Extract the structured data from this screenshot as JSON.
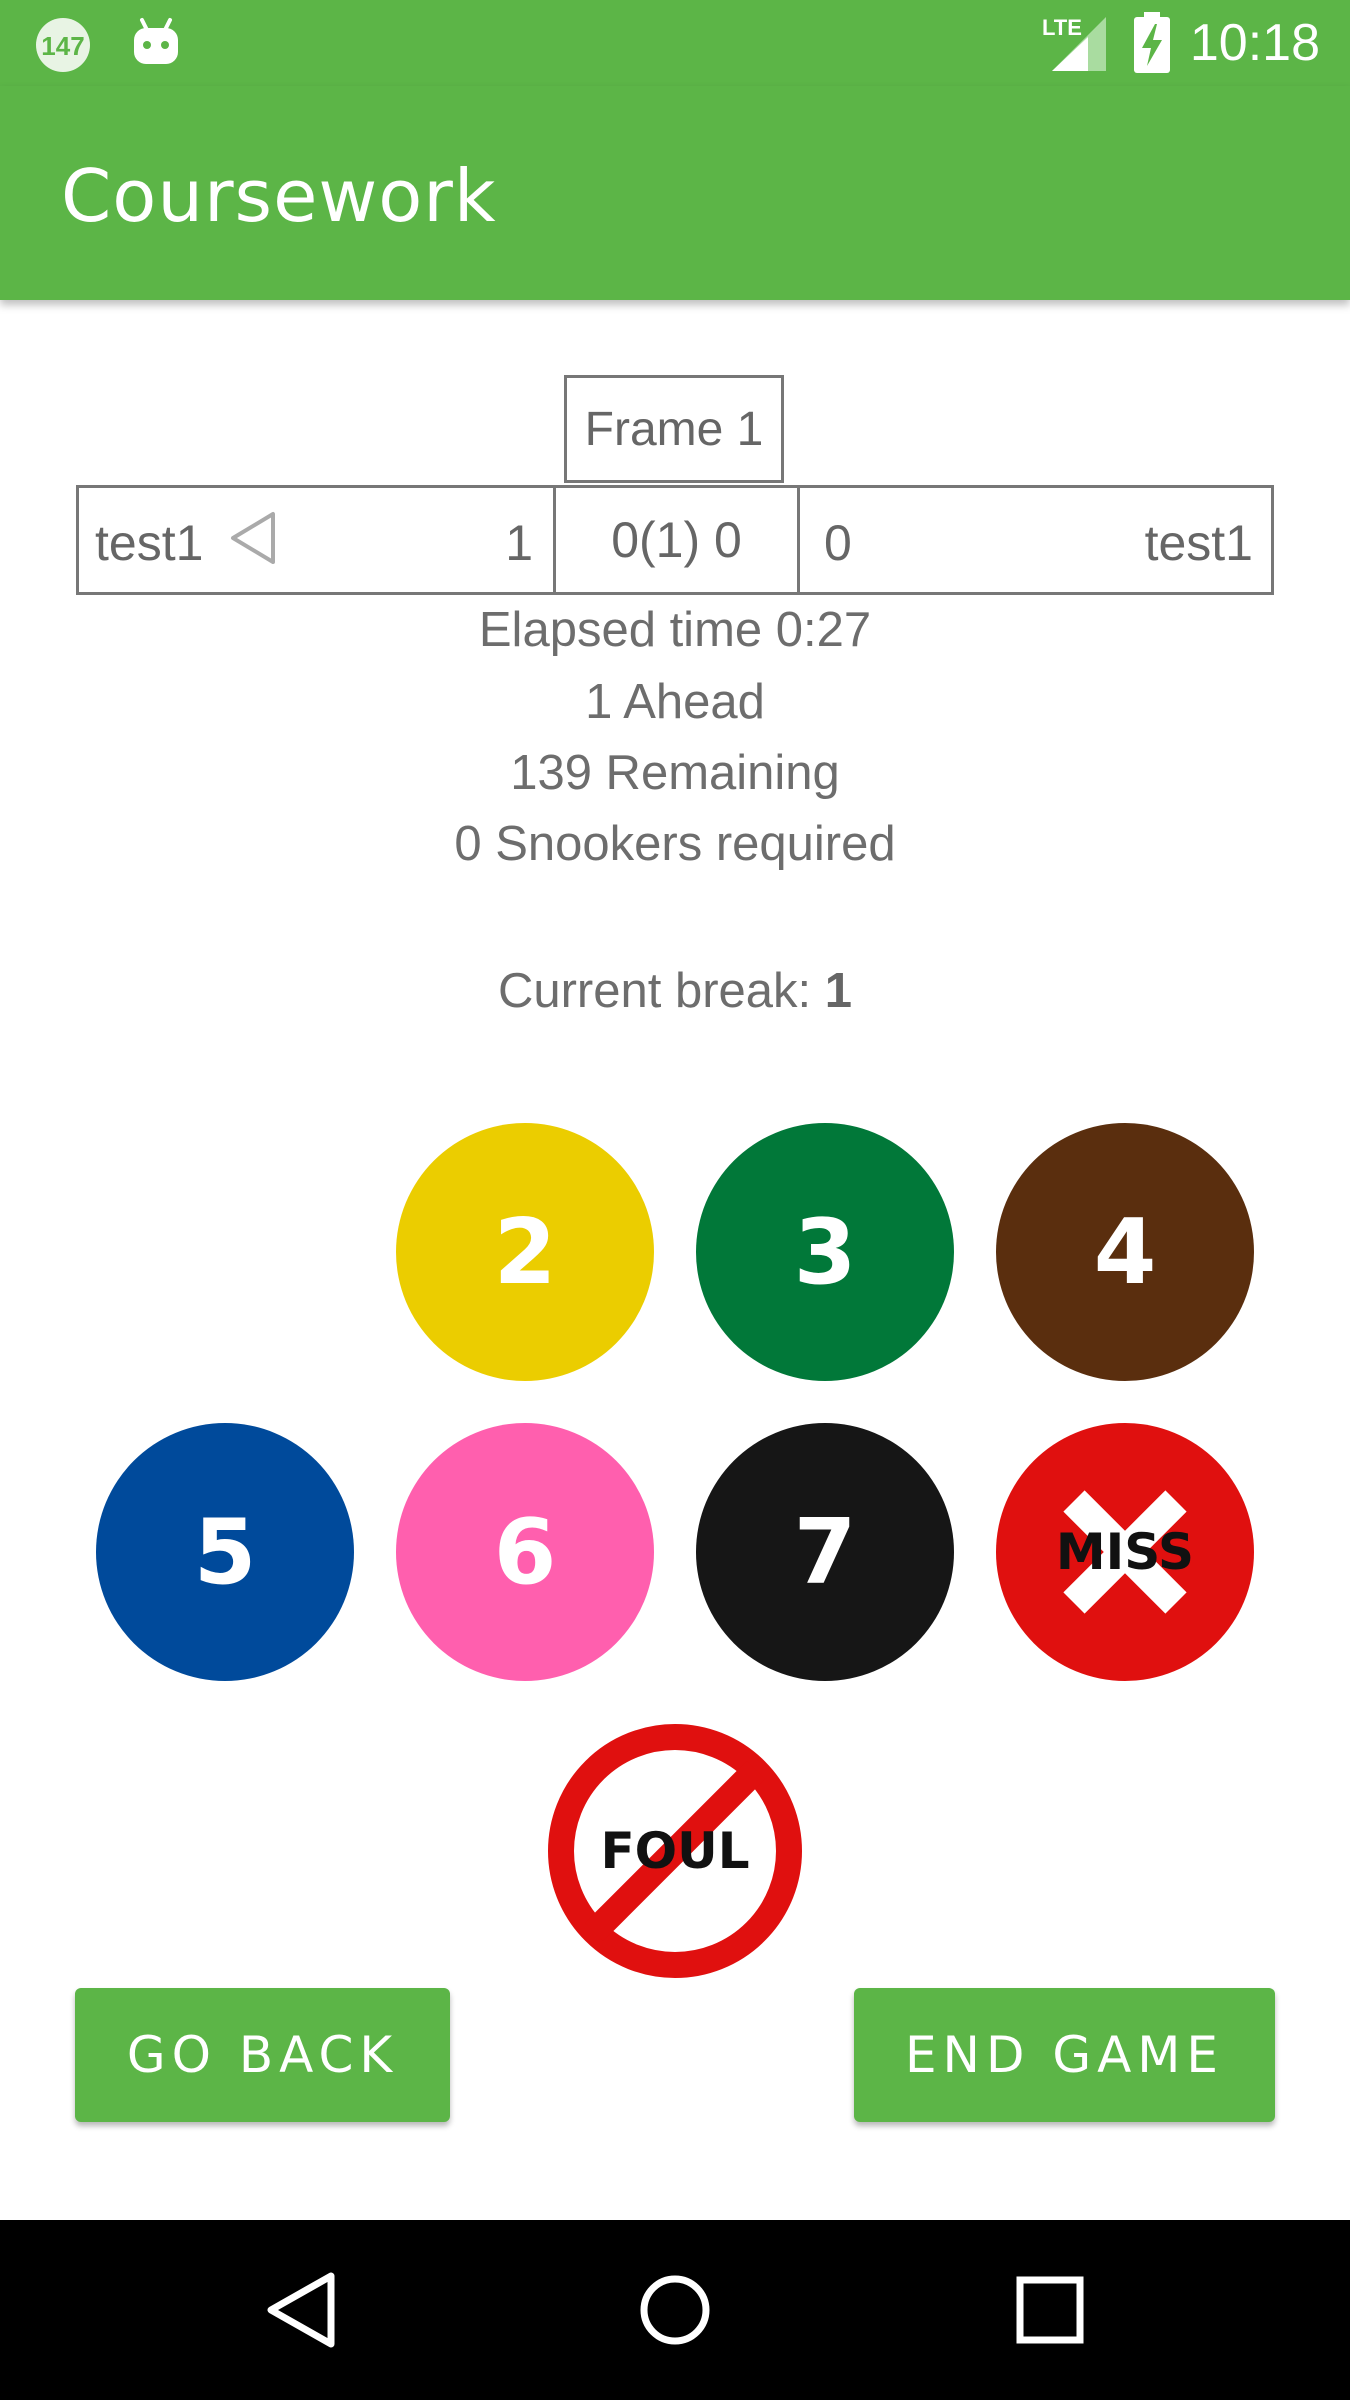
{
  "status_bar": {
    "notification_badge": "147",
    "network_label": "LTE",
    "time": "10:18",
    "icons": [
      "notification-badge-icon",
      "android-icon",
      "signal-icon",
      "battery-charging-icon"
    ]
  },
  "app_bar": {
    "title": "Coursework"
  },
  "frame": {
    "label": "Frame 1"
  },
  "scoreboard": {
    "player1": {
      "name": "test1",
      "score": "1"
    },
    "frames": "0(1) 0",
    "player2": {
      "name": "test1",
      "score": "0"
    }
  },
  "stats": {
    "elapsed": "Elapsed time 0:27",
    "ahead": "1 Ahead",
    "remaining": "139 Remaining",
    "snookers": "0 Snookers required"
  },
  "current_break": {
    "label": "Current break: ",
    "value": "1"
  },
  "balls": [
    {
      "label": "2",
      "color": "#ebcd00"
    },
    {
      "label": "3",
      "color": "#017839"
    },
    {
      "label": "4",
      "color": "#5a2e0e"
    },
    {
      "label": "5",
      "color": "#004a9b"
    },
    {
      "label": "6",
      "color": "#ff5fae"
    },
    {
      "label": "7",
      "color": "#161616"
    }
  ],
  "miss": {
    "label": "MISS",
    "color": "#e0100f"
  },
  "foul": {
    "label": "FOUL",
    "color": "#e0100f"
  },
  "buttons": {
    "go_back": "GO BACK",
    "end_game": "END GAME"
  },
  "accent_color": "#5cb547",
  "nav_bar": {
    "icons": [
      "back-icon",
      "home-icon",
      "recents-icon"
    ]
  }
}
